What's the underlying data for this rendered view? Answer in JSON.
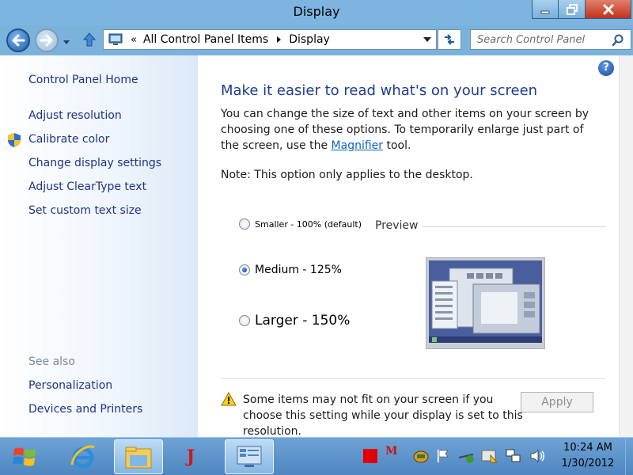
{
  "window": {
    "title": "Display"
  },
  "nav": {
    "breadcrumb_root": "All Control Panel Items",
    "breadcrumb_current": "Display",
    "chevron": "«"
  },
  "search": {
    "placeholder": "Search Control Panel"
  },
  "sidebar": {
    "home": "Control Panel Home",
    "items": [
      "Adjust resolution",
      "Calibrate color",
      "Change display settings",
      "Adjust ClearType text",
      "Set custom text size"
    ],
    "see_also_label": "See also",
    "see_also": [
      "Personalization",
      "Devices and Printers"
    ]
  },
  "main": {
    "help": "?",
    "heading": "Make it easier to read what's on your screen",
    "para_before": "You can change the size of text and other items on your screen by choosing one of these options. To temporarily enlarge just part of the screen, use the ",
    "magnifier_link": "Magnifier",
    "para_after": " tool.",
    "note": "Note: This option only applies to the desktop.",
    "options": [
      {
        "label": "Smaller - 100% (default)",
        "selected": false
      },
      {
        "label": "Medium - 125%",
        "selected": true
      },
      {
        "label": "Larger - 150%",
        "selected": false
      }
    ],
    "preview_label": "Preview",
    "warning": "Some items may not fit on your screen if you choose this setting while your display is set to this resolution.",
    "apply": "Apply"
  },
  "taskbar": {
    "time": "10:24 AM",
    "date": "1/30/2012",
    "java_glyph": "J",
    "mail_glyph": "M"
  },
  "colors": {
    "link": "#1e3287",
    "heading": "#1e3d8f",
    "titlebar": "#7db5e0",
    "taskbar": "#5a90c8"
  }
}
